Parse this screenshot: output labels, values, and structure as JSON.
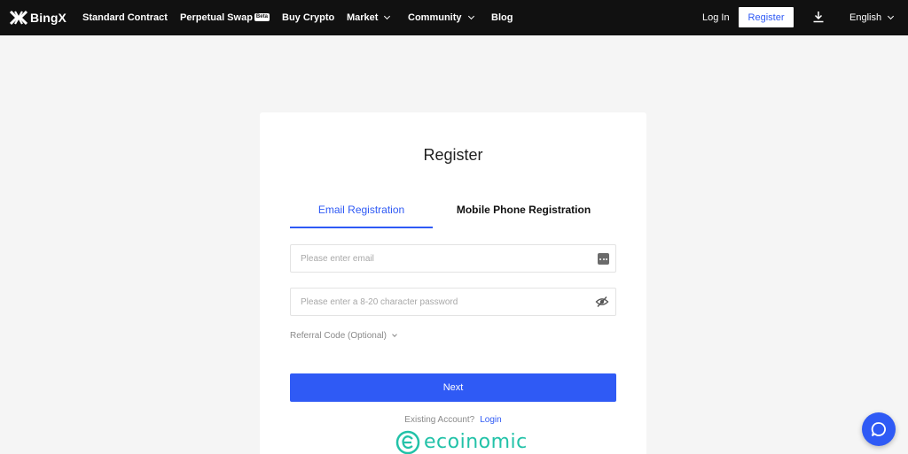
{
  "header": {
    "brand": "BingX",
    "nav": [
      {
        "label": "Standard Contract"
      },
      {
        "label": "Perpetual Swap",
        "badge": "Beta"
      },
      {
        "label": "Buy Crypto"
      },
      {
        "label": "Market"
      },
      {
        "label": "Community"
      },
      {
        "label": "Blog"
      }
    ],
    "login_label": "Log In",
    "register_label": "Register",
    "language": "English"
  },
  "form": {
    "title": "Register",
    "tabs": [
      {
        "label": "Email Registration",
        "active": true
      },
      {
        "label": "Mobile Phone Registration",
        "active": false
      }
    ],
    "email_placeholder": "Please enter email",
    "password_placeholder": "Please enter a 8-20 character password",
    "referral_label": "Referral Code (Optional)",
    "next_label": "Next",
    "existing_text": "Existing Account?",
    "login_link": "Login"
  },
  "watermark": {
    "text": "ecoinomic"
  },
  "colors": {
    "accent": "#2f5af5",
    "topbar": "#111111",
    "watermark": "#22c2a8"
  }
}
